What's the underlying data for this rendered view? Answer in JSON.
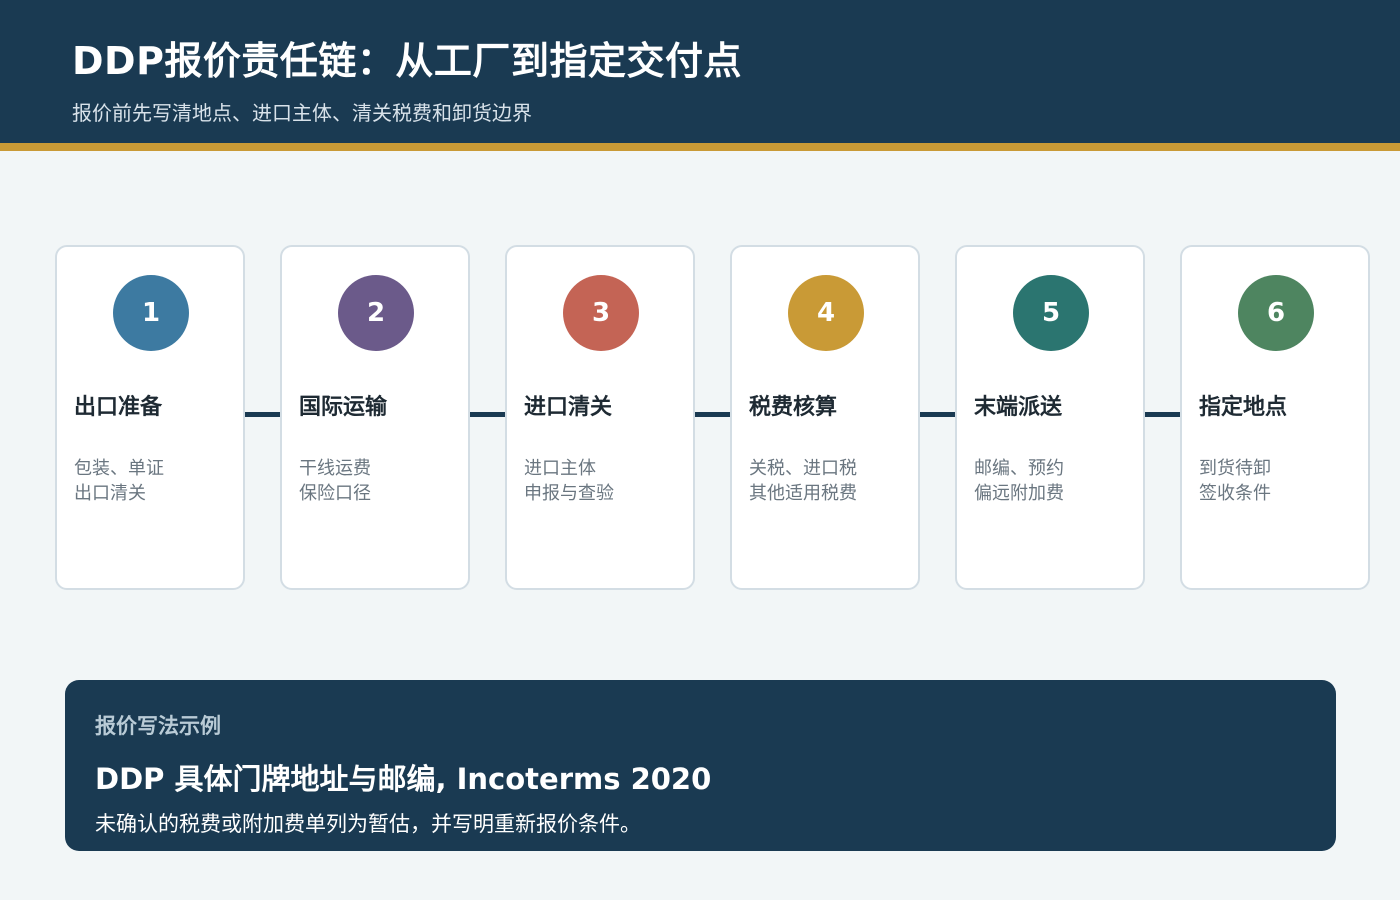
{
  "header": {
    "title": "DDP报价责任链：从工厂到指定交付点",
    "subtitle": "报价前先写清地点、进口主体、清关税费和卸货边界"
  },
  "colors": {
    "header_bg": "#1a3a52",
    "accent": "#c99a36"
  },
  "steps": [
    {
      "number": "1",
      "title": "出口准备",
      "line1": "包装、单证",
      "line2": "出口清关",
      "color": "#3d7aa1"
    },
    {
      "number": "2",
      "title": "国际运输",
      "line1": "干线运费",
      "line2": "保险口径",
      "color": "#6b5a8a"
    },
    {
      "number": "3",
      "title": "进口清关",
      "line1": "进口主体",
      "line2": "申报与查验",
      "color": "#c46455"
    },
    {
      "number": "4",
      "title": "税费核算",
      "line1": "关税、进口税",
      "line2": "其他适用税费",
      "color": "#c99a36"
    },
    {
      "number": "5",
      "title": "末端派送",
      "line1": "邮编、预约",
      "line2": "偏远附加费",
      "color": "#2b7570"
    },
    {
      "number": "6",
      "title": "指定地点",
      "line1": "到货待卸",
      "line2": "签收条件",
      "color": "#4e8560"
    }
  ],
  "example": {
    "label": "报价写法示例",
    "main": "DDP 具体门牌地址与邮编, Incoterms 2020",
    "note": "未确认的税费或附加费单列为暂估，并写明重新报价条件。"
  }
}
